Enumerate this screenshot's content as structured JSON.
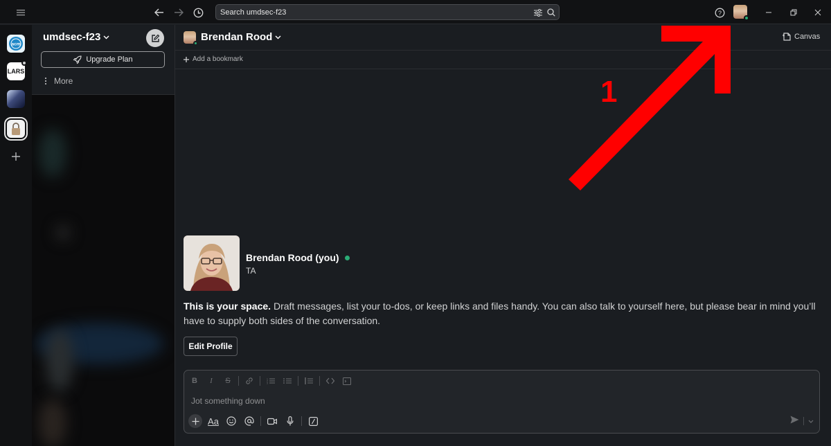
{
  "titlebar": {
    "search_placeholder": "Search umdsec-f23"
  },
  "rail": {
    "workspaces": [
      {
        "label": "acm",
        "color": "#1e88c8"
      },
      {
        "label": "LARS",
        "color": "#ffffff"
      },
      {
        "label": "",
        "color": "#3d4a7a"
      },
      {
        "label": "",
        "color": "#f2f2f2"
      }
    ]
  },
  "sidebar": {
    "workspace_name": "umdsec-f23",
    "upgrade_label": "Upgrade Plan",
    "more_label": "More"
  },
  "channel": {
    "title": "Brendan Rood",
    "canvas_label": "Canvas",
    "bookmark_label": "Add a bookmark"
  },
  "profile": {
    "name": "Brendan Rood (you)",
    "role": "TA",
    "intro_bold": "This is your space.",
    "intro_rest": " Draft messages, list your to-dos, or keep links and files handy. You can also talk to yourself here, but please bear in mind you’ll have to supply both sides of the conversation.",
    "edit_label": "Edit Profile"
  },
  "composer": {
    "placeholder": "Jot something down",
    "aa_label": "Aa"
  },
  "annotation": {
    "number": "1",
    "color": "#ff0000"
  },
  "colors": {
    "online": "#2bac76",
    "background": "#1a1d21"
  }
}
